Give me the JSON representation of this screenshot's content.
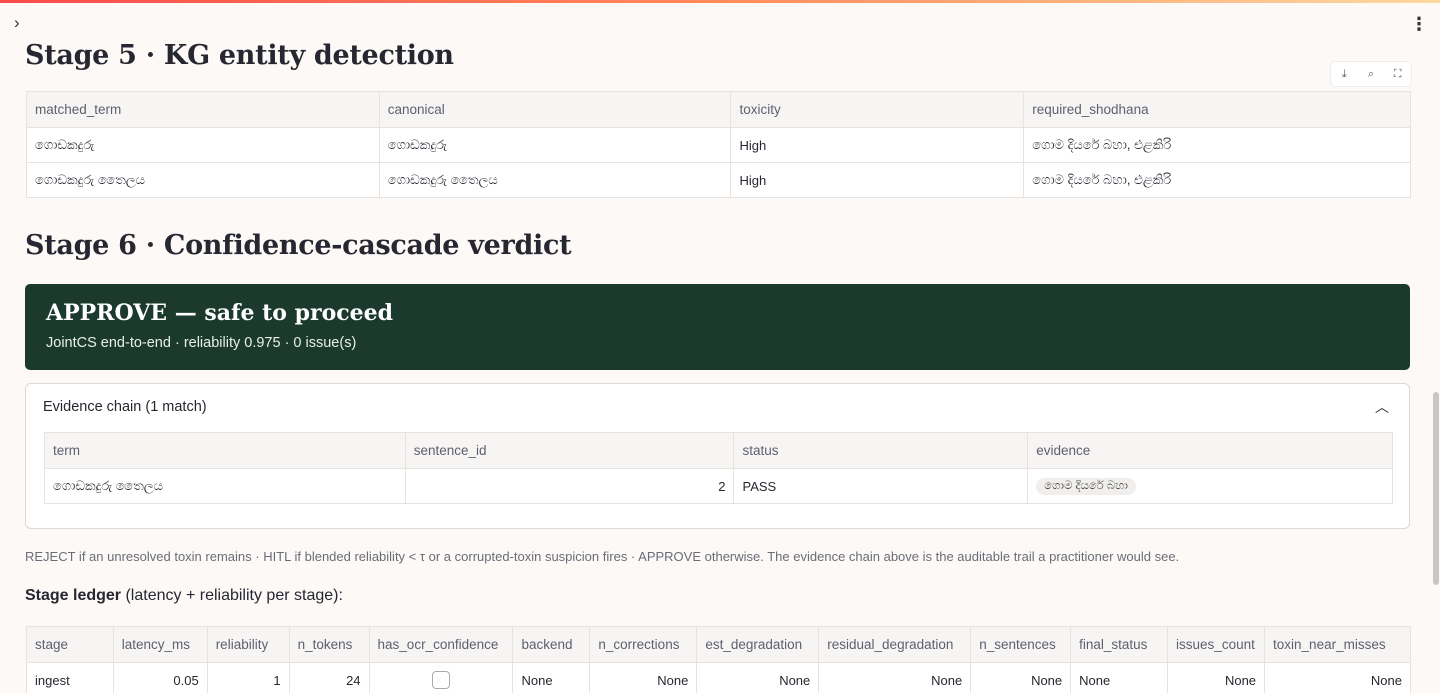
{
  "stage5": {
    "heading": "Stage 5 · KG entity detection",
    "columns": [
      "matched_term",
      "canonical",
      "toxicity",
      "required_shodhana"
    ],
    "rows": [
      [
        "ගොඩකදුරු",
        "ගොඩකදුරු",
        "High",
        "ගොම දියරේ බහා, එළකිරි"
      ],
      [
        "ගොඩකදුරු තෛලය",
        "ගොඩකදුරු තෛලය",
        "High",
        "ගොම දියරේ බහා, එළකිරි"
      ]
    ]
  },
  "toolbar": {
    "download_icon": "download-icon",
    "search_icon": "search-icon",
    "fullscreen_icon": "fullscreen-icon"
  },
  "stage6": {
    "heading": "Stage 6 · Confidence-cascade verdict",
    "verdict_title": "APPROVE — safe to proceed",
    "verdict_sub": "JointCS end-to-end · reliability 0.975 · 0 issue(s)",
    "verdict_color": "#1b3a2d"
  },
  "evidence": {
    "label": "Evidence chain (1 match)",
    "columns": [
      "term",
      "sentence_id",
      "status",
      "evidence"
    ],
    "rows": [
      [
        "ගොඩකදුරු තෛලය",
        "2",
        "PASS",
        "ගොම දියරේ බහා"
      ]
    ]
  },
  "caption": "REJECT if an unresolved toxin remains · HITL if blended reliability < τ or a corrupted-toxin suspicion fires · APPROVE otherwise. The evidence chain above is the auditable trail a practitioner would see.",
  "ledger": {
    "bold": "Stage ledger",
    "rest": " (latency + reliability per stage):",
    "columns": [
      "stage",
      "latency_ms",
      "reliability",
      "n_tokens",
      "has_ocr_confidence",
      "backend",
      "n_corrections",
      "est_degradation",
      "residual_degradation",
      "n_sentences",
      "final_status",
      "issues_count",
      "toxin_near_misses"
    ],
    "rows": [
      [
        "ingest",
        "0.05",
        "1",
        "24",
        "",
        "None",
        "None",
        "None",
        "None",
        "None",
        "None",
        "None",
        "None"
      ]
    ]
  }
}
